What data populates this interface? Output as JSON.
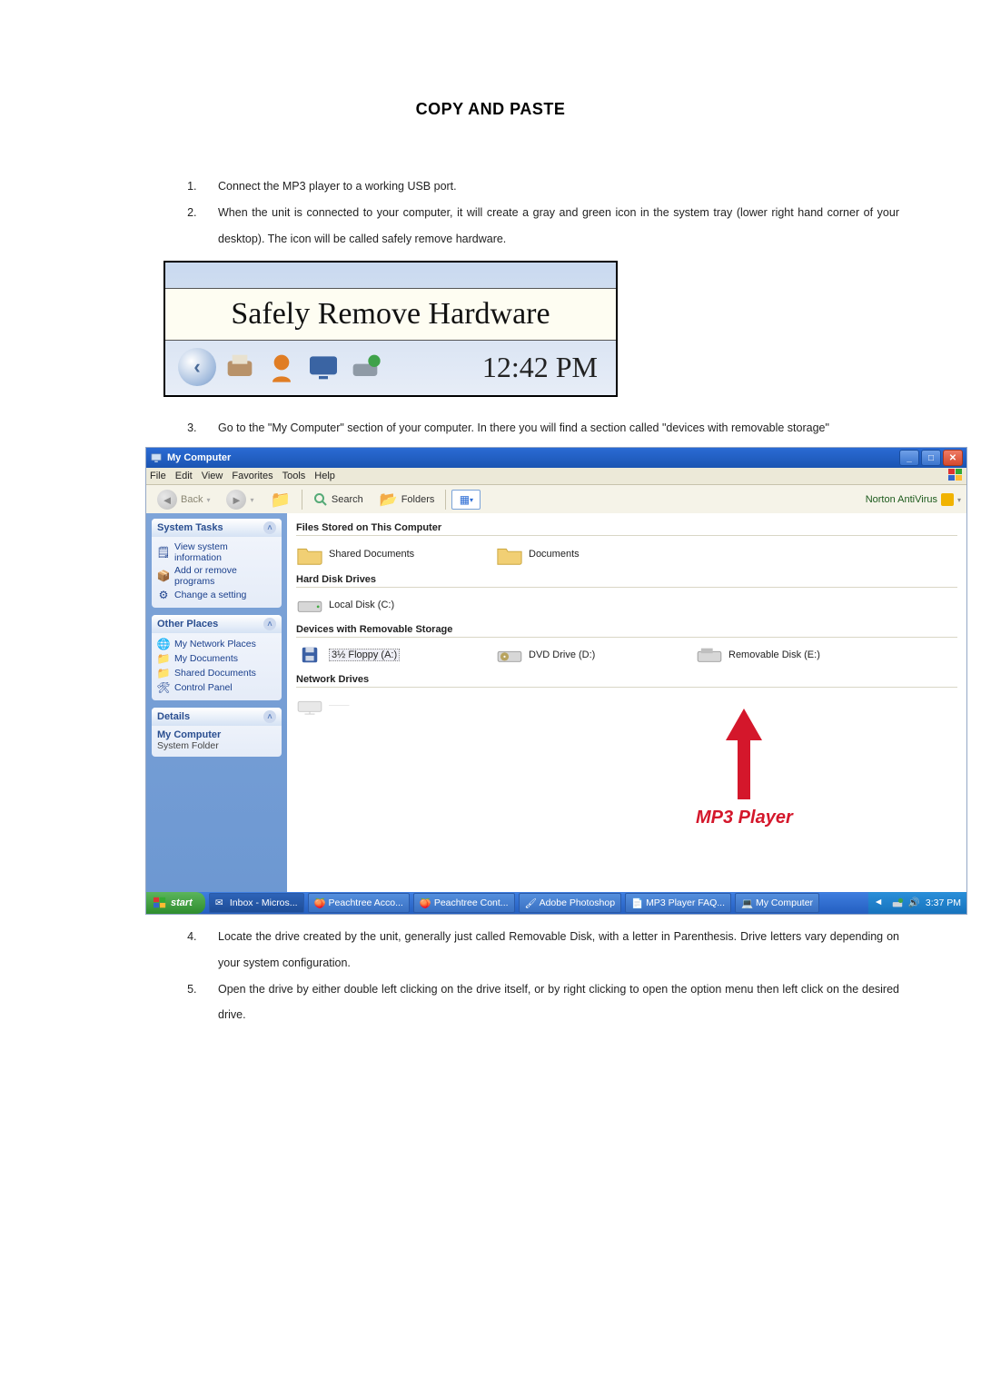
{
  "doc": {
    "title": "COPY AND PASTE",
    "steps": [
      "Connect the MP3 player to a working USB port.",
      "When the unit is connected to your computer, it will create a gray and green icon in the system tray (lower right hand corner of your desktop). The icon will be called safely remove hardware.",
      "Go to the \"My Computer\" section of your computer. In there you will find a section called \"devices with removable storage\"",
      "Locate the drive created by the unit, generally just called Removable Disk, with a letter in Parenthesis. Drive letters vary depending on your system configuration.",
      "Open the drive by either double left clicking on the drive itself, or by right clicking to open the option menu then left click on the desired drive."
    ]
  },
  "tray": {
    "tooltip": "Safely Remove Hardware",
    "time": "12:42 PM"
  },
  "win": {
    "title": "My Computer",
    "menu": [
      "File",
      "Edit",
      "View",
      "Favorites",
      "Tools",
      "Help"
    ],
    "toolbar": {
      "back": "Back",
      "search": "Search",
      "folders": "Folders",
      "norton": "Norton AntiVirus"
    },
    "sidebar": {
      "systemTasks": {
        "header": "System Tasks",
        "items": [
          "View system information",
          "Add or remove programs",
          "Change a setting"
        ]
      },
      "otherPlaces": {
        "header": "Other Places",
        "items": [
          "My Network Places",
          "My Documents",
          "Shared Documents",
          "Control Panel"
        ]
      },
      "details": {
        "header": "Details",
        "line1": "My Computer",
        "line2": "System Folder"
      }
    },
    "content": {
      "filesHeader": "Files Stored on This Computer",
      "filesItems": [
        "Shared Documents",
        "Documents"
      ],
      "hddHeader": "Hard Disk Drives",
      "hddItems": [
        "Local Disk (C:)"
      ],
      "removableHeader": "Devices with Removable Storage",
      "removableItems": [
        "3½ Floppy (A:)",
        "DVD Drive (D:)",
        "Removable Disk (E:)"
      ],
      "networkHeader": "Network Drives"
    },
    "annotation": "MP3 Player",
    "taskbar": {
      "start": "start",
      "buttons": [
        "Inbox - Micros...",
        "Peachtree Acco...",
        "Peachtree Cont...",
        "Adobe Photoshop",
        "MP3 Player FAQ...",
        "My Computer"
      ],
      "clock": "3:37 PM"
    }
  }
}
